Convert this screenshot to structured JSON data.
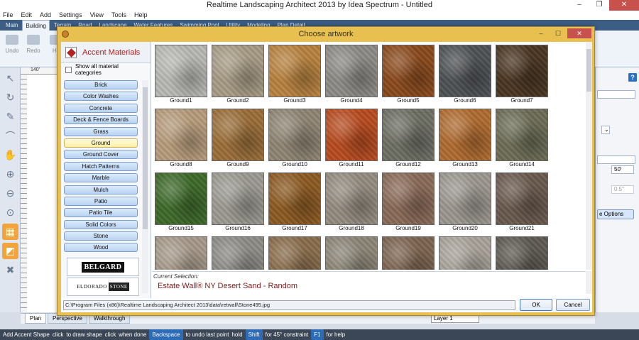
{
  "app": {
    "title": "Realtime Landscaping Architect 2013 by Idea Spectrum - Untitled"
  },
  "menu": [
    "File",
    "Edit",
    "Add",
    "Settings",
    "View",
    "Tools",
    "Help"
  ],
  "ribbon_tabs": [
    "Main",
    "Building",
    "Terrain",
    "Road",
    "Landscape",
    "Water Features",
    "Swimming Pool",
    "Utility",
    "Modeling",
    "Plan Detail"
  ],
  "ribbon": {
    "undo": "Undo",
    "redo": "Redo",
    "ho": "Ho"
  },
  "ruler": {
    "mark": "140'"
  },
  "right_panel": {
    "help": "?",
    "value1": "50'",
    "value2": "0.5\"",
    "options_btn": "e Options"
  },
  "bottom_tabs": [
    "Plan",
    "Perspective",
    "Walkthrough"
  ],
  "layer": "Layer 1",
  "status": {
    "action": "Add Accent Shape",
    "t1": "click",
    "t2": "to draw shape",
    "t3": "click",
    "t4": "when done",
    "k1": "Backspace",
    "t5": "to undo last point",
    "t6": "hold",
    "k2": "Shift",
    "t7": "for 45° constraint",
    "k3": "F1",
    "t8": "for help"
  },
  "dialog": {
    "title": "Choose artwork",
    "heading": "Accent Materials",
    "show_all": "Show all material categories",
    "categories": [
      "Brick",
      "Color Washes",
      "Concrete",
      "Deck & Fence Boards",
      "Grass",
      "Ground",
      "Ground Cover",
      "Hatch Patterns",
      "Marble",
      "Mulch",
      "Patio",
      "Patio Tile",
      "Solid Colors",
      "Stone",
      "Wood"
    ],
    "selected_category": "Ground",
    "logos": {
      "belgard": "BELGARD",
      "eldorado_1": "ELDORADO",
      "eldorado_2": "STONE"
    },
    "tiles": [
      {
        "label": "Ground1",
        "color": "#b8b8b4"
      },
      {
        "label": "Ground2",
        "color": "#a89c86"
      },
      {
        "label": "Ground3",
        "color": "#b8823f"
      },
      {
        "label": "Ground4",
        "color": "#8d8b86"
      },
      {
        "label": "Ground5",
        "color": "#8b4a1d"
      },
      {
        "label": "Ground6",
        "color": "#4f5255"
      },
      {
        "label": "Ground7",
        "color": "#4a3522"
      },
      {
        "label": "Ground8",
        "color": "#b79c7c"
      },
      {
        "label": "Ground9",
        "color": "#9b6e38"
      },
      {
        "label": "Ground10",
        "color": "#8f8574"
      },
      {
        "label": "Ground11",
        "color": "#b84b1f"
      },
      {
        "label": "Ground12",
        "color": "#6e6f64"
      },
      {
        "label": "Ground13",
        "color": "#b06b30"
      },
      {
        "label": "Ground14",
        "color": "#6c6c56"
      },
      {
        "label": "Ground15",
        "color": "#3e6a2a"
      },
      {
        "label": "Ground16",
        "color": "#9c9a92"
      },
      {
        "label": "Ground17",
        "color": "#8c5a22"
      },
      {
        "label": "Ground18",
        "color": "#958c80"
      },
      {
        "label": "Ground19",
        "color": "#8a6a58"
      },
      {
        "label": "Ground20",
        "color": "#9c9790"
      },
      {
        "label": "Ground21",
        "color": "#6a5a4e"
      },
      {
        "label": "",
        "color": "#a7998a"
      },
      {
        "label": "",
        "color": "#8d8c87"
      },
      {
        "label": "",
        "color": "#8a6d4c"
      },
      {
        "label": "",
        "color": "#8c8577"
      },
      {
        "label": "",
        "color": "#7d6450"
      },
      {
        "label": "",
        "color": "#a9a39a"
      },
      {
        "label": "",
        "color": "#5e5a52"
      }
    ],
    "current_selection_label": "Current Selection:",
    "current_selection": "Estate Wall® NY Desert Sand - Random",
    "path": "C:\\Program Files (x86)\\Realtime Landscaping Architect 2013\\data\\retwall\\Stone495.jpg",
    "ok": "OK",
    "cancel": "Cancel"
  }
}
